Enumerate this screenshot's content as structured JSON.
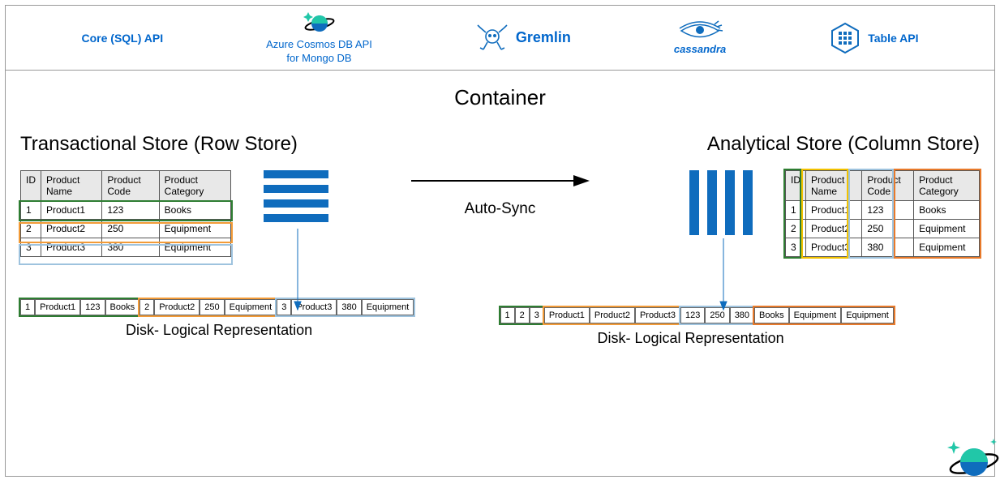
{
  "diagram": {
    "apis": {
      "core": "Core (SQL) API",
      "mongo_line1": "Azure Cosmos DB API",
      "mongo_line2": "for Mongo DB",
      "gremlin": "Gremlin",
      "cassandra": "cassandra",
      "table": "Table API"
    },
    "container_title": "Container",
    "auto_sync": "Auto-Sync",
    "left": {
      "title": "Transactional Store (Row Store)",
      "headers": {
        "id": "ID",
        "name": "Product Name",
        "code": "Product Code",
        "cat": "Product Category"
      },
      "rows": [
        {
          "id": "1",
          "name": "Product1",
          "code": "123",
          "cat": "Books"
        },
        {
          "id": "2",
          "name": "Product2",
          "code": "250",
          "cat": "Equipment"
        },
        {
          "id": "3",
          "name": "Product3",
          "code": "380",
          "cat": "Equipment"
        }
      ],
      "disk_label": "Disk- Logical Representation"
    },
    "right": {
      "title": "Analytical Store (Column Store)",
      "headers": {
        "id": "ID",
        "name": "Product Name",
        "code": "Product Code",
        "cat": "Product Category"
      },
      "rows": [
        {
          "id": "1",
          "name": "Product1",
          "code": "123",
          "cat": "Books"
        },
        {
          "id": "2",
          "name": "Product2",
          "code": "250",
          "cat": "Equipment"
        },
        {
          "id": "3",
          "name": "Product3",
          "code": "380",
          "cat": "Equipment"
        }
      ],
      "disk_label": "Disk- Logical Representation"
    }
  }
}
